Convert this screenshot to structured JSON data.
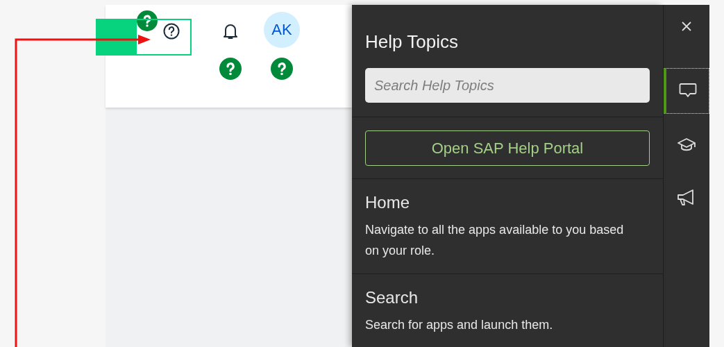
{
  "header": {
    "avatar": "AK"
  },
  "help_panel": {
    "title": "Help Topics",
    "search": {
      "placeholder": "Search Help Topics"
    },
    "portal_button": "Open SAP Help Portal",
    "topics": [
      {
        "title": "Home",
        "description": "Navigate to all the apps available to you based on your role."
      },
      {
        "title": "Search",
        "description": "Search for apps and launch them."
      }
    ]
  },
  "rail": {
    "items": [
      {
        "kind": "close",
        "selected": false
      },
      {
        "kind": "chat",
        "selected": true
      },
      {
        "kind": "learning",
        "selected": false
      },
      {
        "kind": "announcement",
        "selected": false
      }
    ]
  }
}
